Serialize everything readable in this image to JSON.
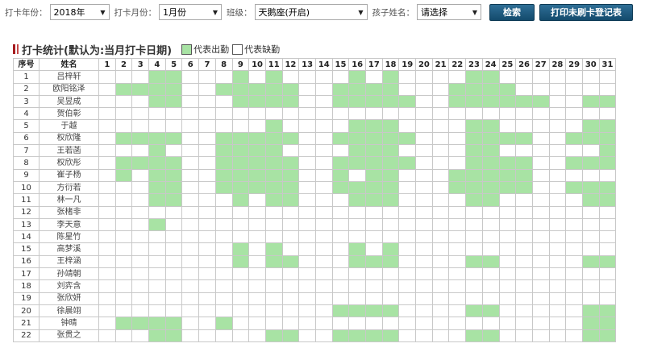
{
  "filters": {
    "year_label": "打卡年份：",
    "year_value": "2018年",
    "month_label": "打卡月份：",
    "month_value": "1月份",
    "class_label": "班级：",
    "class_value": "天鹅座(开启)",
    "child_label": "孩子姓名：",
    "child_placeholder": "请选择"
  },
  "buttons": {
    "search": "检索",
    "print": "打印未刷卡登记表"
  },
  "section": {
    "title": "打卡统计(默认为:当月打卡日期)",
    "legend_present": "代表出勤",
    "legend_absent": "代表缺勤"
  },
  "colors": {
    "present": "#a8e3a4",
    "absent": "#ffffff",
    "button": "#1e5a80"
  },
  "table": {
    "header_index": "序号",
    "header_name": "姓名",
    "days": [
      "1",
      "2",
      "3",
      "4",
      "5",
      "6",
      "7",
      "8",
      "9",
      "10",
      "11",
      "12",
      "13",
      "14",
      "15",
      "16",
      "17",
      "18",
      "19",
      "20",
      "21",
      "22",
      "23",
      "24",
      "25",
      "26",
      "27",
      "28",
      "29",
      "30",
      "31"
    ],
    "rows": [
      {
        "index": "1",
        "name": "吕梓轩",
        "present": [
          4,
          5,
          9,
          11,
          16,
          18,
          23,
          24
        ]
      },
      {
        "index": "2",
        "name": "欧阳铭泽",
        "present": [
          2,
          3,
          4,
          5,
          8,
          9,
          10,
          11,
          12,
          15,
          16,
          17,
          18,
          22,
          23,
          24,
          25
        ]
      },
      {
        "index": "3",
        "name": "吴昱成",
        "present": [
          4,
          5,
          9,
          10,
          11,
          12,
          15,
          16,
          17,
          18,
          19,
          22,
          23,
          24,
          25,
          26,
          27,
          30,
          31
        ]
      },
      {
        "index": "4",
        "name": "贺伯彰",
        "present": []
      },
      {
        "index": "5",
        "name": "于越",
        "present": [
          11,
          16,
          17,
          18,
          23,
          24,
          30,
          31
        ]
      },
      {
        "index": "6",
        "name": "权欣隆",
        "present": [
          2,
          3,
          4,
          5,
          8,
          9,
          10,
          11,
          12,
          15,
          16,
          17,
          18,
          19,
          23,
          24,
          25,
          26,
          29,
          30,
          31
        ]
      },
      {
        "index": "7",
        "name": "王若菡",
        "present": [
          4,
          8,
          9,
          10,
          11,
          16,
          17,
          18,
          23,
          24,
          31
        ]
      },
      {
        "index": "8",
        "name": "权欣彤",
        "present": [
          2,
          3,
          4,
          5,
          8,
          9,
          10,
          11,
          12,
          15,
          16,
          17,
          18,
          19,
          23,
          24,
          25,
          26,
          29,
          30,
          31
        ]
      },
      {
        "index": "9",
        "name": "崔子杨",
        "present": [
          2,
          4,
          5,
          8,
          9,
          10,
          11,
          12,
          15,
          17,
          18,
          22,
          23,
          24,
          25,
          26
        ]
      },
      {
        "index": "10",
        "name": "方衍若",
        "present": [
          4,
          5,
          8,
          9,
          10,
          11,
          12,
          15,
          16,
          17,
          18,
          22,
          23,
          24,
          25,
          26,
          29,
          30,
          31
        ]
      },
      {
        "index": "11",
        "name": "林一凡",
        "present": [
          4,
          5,
          9,
          11,
          12,
          16,
          17,
          18,
          23,
          24,
          30,
          31
        ]
      },
      {
        "index": "12",
        "name": "张楮非",
        "present": []
      },
      {
        "index": "13",
        "name": "李天意",
        "present": [
          4
        ]
      },
      {
        "index": "14",
        "name": "陈星竹",
        "present": []
      },
      {
        "index": "15",
        "name": "高梦溪",
        "present": [
          9,
          11,
          16,
          18
        ]
      },
      {
        "index": "16",
        "name": "王梓涵",
        "present": [
          9,
          11,
          12,
          16,
          17,
          18,
          23,
          24,
          30,
          31
        ]
      },
      {
        "index": "17",
        "name": "孙靖朝",
        "present": []
      },
      {
        "index": "18",
        "name": "刘弈含",
        "present": []
      },
      {
        "index": "19",
        "name": "张欣妍",
        "present": []
      },
      {
        "index": "20",
        "name": "徐晨翊",
        "present": [
          15,
          16,
          17,
          18,
          23,
          24,
          30,
          31
        ]
      },
      {
        "index": "21",
        "name": "钟晴",
        "present": [
          2,
          3,
          4,
          5,
          8,
          30,
          31
        ]
      },
      {
        "index": "22",
        "name": "张贯之",
        "present": [
          4,
          5,
          11,
          12,
          15,
          16,
          17,
          18,
          23,
          24,
          30,
          31
        ]
      }
    ]
  }
}
